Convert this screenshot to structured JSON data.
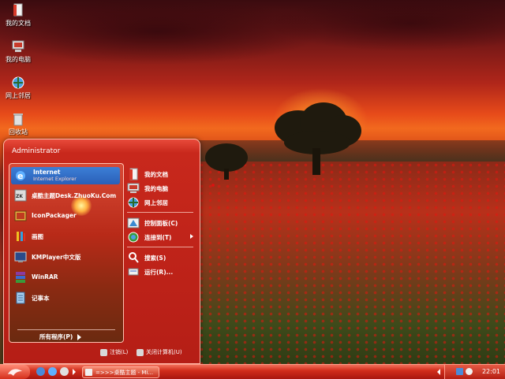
{
  "desktop": {
    "icons": [
      {
        "label": "我的文档",
        "icon": "my-documents-icon"
      },
      {
        "label": "我的电脑",
        "icon": "my-computer-icon"
      },
      {
        "label": "网上邻居",
        "icon": "network-places-icon"
      },
      {
        "label": "回收站",
        "icon": "recycle-bin-icon"
      }
    ]
  },
  "start_menu": {
    "user": "Administrator",
    "left_items": [
      {
        "label": "Internet",
        "sub": "Internet Explorer",
        "icon": "internet-explorer-icon"
      },
      {
        "label": "桌酷主题Desk.ZhuoKu.Com",
        "icon": "zhuoku-theme-icon"
      },
      {
        "label": "IconPackager",
        "icon": "iconpackager-icon"
      },
      {
        "label": "画图",
        "icon": "paint-icon"
      },
      {
        "label": "KMPlayer中文版",
        "icon": "kmplayer-icon"
      },
      {
        "label": "WinRAR",
        "icon": "winrar-icon"
      },
      {
        "label": "记事本",
        "icon": "notepad-icon"
      }
    ],
    "all_programs": "所有程序(P)",
    "right_items": [
      {
        "label": "我的文档",
        "icon": "my-documents-icon"
      },
      {
        "label": "我的电脑",
        "icon": "my-computer-icon"
      },
      {
        "label": "网上邻居",
        "icon": "network-places-icon"
      },
      {
        "label": "控制面板(C)",
        "icon": "control-panel-icon"
      },
      {
        "label": "连接到(T)",
        "icon": "connect-to-icon"
      },
      {
        "label": "搜索(S)",
        "icon": "search-icon"
      },
      {
        "label": "运行(R)...",
        "icon": "run-icon"
      }
    ],
    "logoff": "注销(L)",
    "shutdown": "关闭计算机(U)"
  },
  "taskbar": {
    "task_label": "=>>>桌酷主题 - Mi...",
    "clock": "22:01"
  },
  "colors": {
    "accent": "#d22e1c",
    "selection": "#2a5fb8"
  }
}
